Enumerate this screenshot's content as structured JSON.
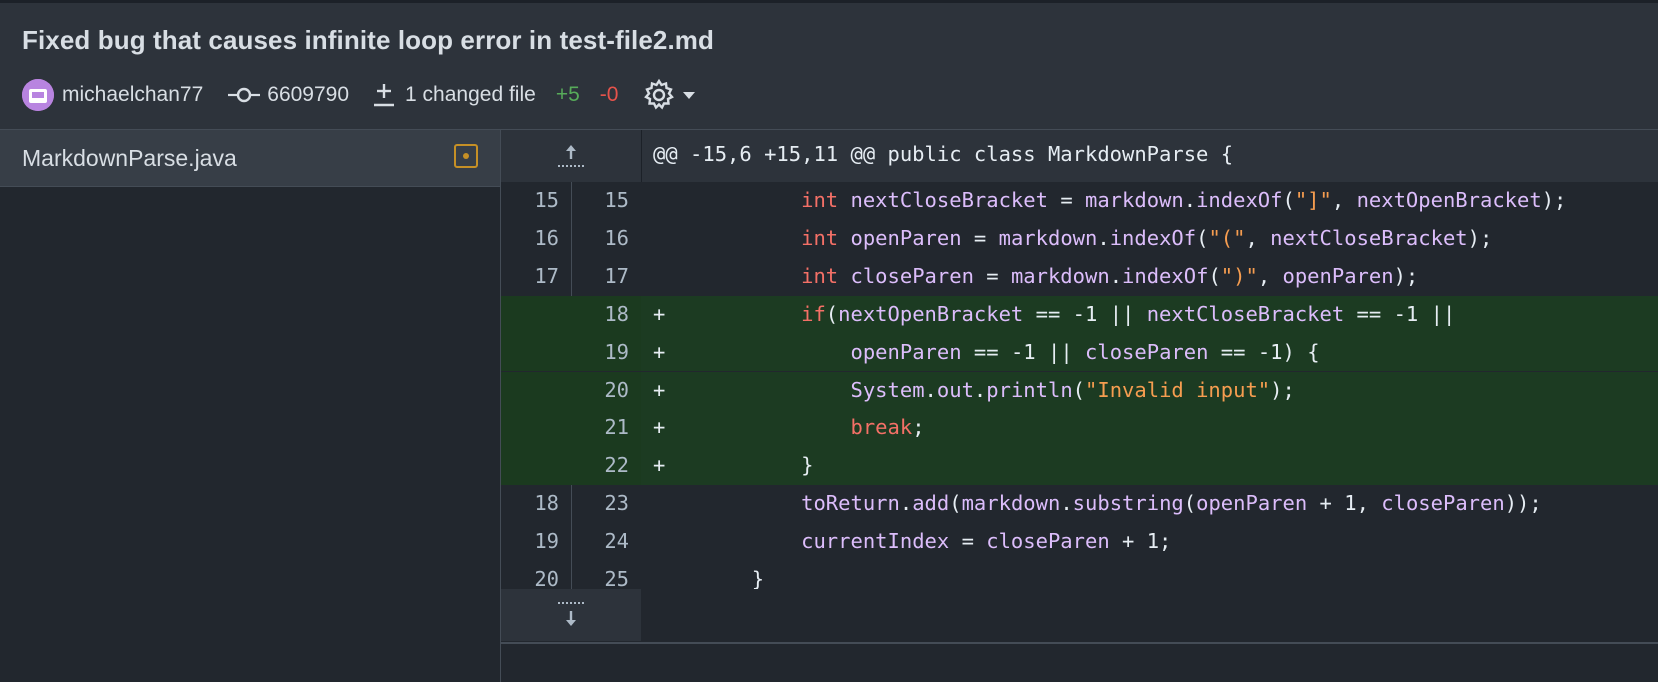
{
  "commit": {
    "title": "Fixed bug that causes infinite loop error in test-file2.md",
    "author": "michaelchan77",
    "sha": "6609790",
    "changed_files": "1 changed file",
    "additions": "+5",
    "deletions": "-0"
  },
  "sidebar": {
    "files": [
      {
        "name": "MarkdownParse.java",
        "status": "modified"
      }
    ]
  },
  "diff": {
    "hunk_header": "@@ -15,6 +15,11 @@ public class MarkdownParse {",
    "lines": [
      {
        "old": "15",
        "new": "15",
        "type": "context",
        "sign": "",
        "code": "            int nextCloseBracket = markdown.indexOf(\"]\", nextOpenBracket);"
      },
      {
        "old": "16",
        "new": "16",
        "type": "context",
        "sign": "",
        "code": "            int openParen = markdown.indexOf(\"(\", nextCloseBracket);"
      },
      {
        "old": "17",
        "new": "17",
        "type": "context",
        "sign": "",
        "code": "            int closeParen = markdown.indexOf(\")\", openParen);"
      },
      {
        "old": "",
        "new": "18",
        "type": "added",
        "sign": "+",
        "code": "            if(nextOpenBracket == -1 || nextCloseBracket == -1 ||"
      },
      {
        "old": "",
        "new": "19",
        "type": "added",
        "sign": "+",
        "code": "                openParen == -1 || closeParen == -1) {"
      },
      {
        "old": "",
        "new": "20",
        "type": "added",
        "sign": "+",
        "code": "                System.out.println(\"Invalid input\");"
      },
      {
        "old": "",
        "new": "21",
        "type": "added",
        "sign": "+",
        "code": "                break;"
      },
      {
        "old": "",
        "new": "22",
        "type": "added",
        "sign": "+",
        "code": "            }"
      },
      {
        "old": "18",
        "new": "23",
        "type": "context",
        "sign": "",
        "code": "            toReturn.add(markdown.substring(openParen + 1, closeParen));"
      },
      {
        "old": "19",
        "new": "24",
        "type": "context",
        "sign": "",
        "code": "            currentIndex = closeParen + 1;"
      },
      {
        "old": "20",
        "new": "25",
        "type": "context",
        "sign": "",
        "code": "        }"
      }
    ]
  },
  "colors": {
    "added_bg": "#1c3b22",
    "addition_text": "#57ab5a",
    "deletion_text": "#e5534b",
    "keyword": "#f47067",
    "identifier": "#dcbdfb",
    "string": "#f69d50"
  },
  "icons": [
    "avatar",
    "commit-icon",
    "diff-icon",
    "gear-icon",
    "chevron-down-icon",
    "file-modified-icon",
    "expand-up-icon",
    "expand-down-icon"
  ]
}
